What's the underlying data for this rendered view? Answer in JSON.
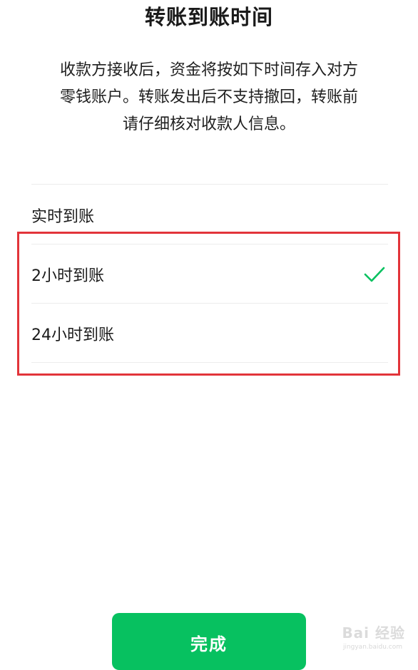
{
  "header": {
    "title": "转账到账时间"
  },
  "description": {
    "lines": [
      "收款方接收后，资金将按如下时间存入对方",
      "零钱账户。转账发出后不支持撤回，转账前",
      "请仔细核对收款人信息。"
    ]
  },
  "options": [
    {
      "label": "实时到账",
      "selected": false
    },
    {
      "label": "2小时到账",
      "selected": true
    },
    {
      "label": "24小时到账",
      "selected": false
    }
  ],
  "footer": {
    "done_label": "完成"
  },
  "watermark": {
    "brand": "Bai 经验",
    "sub": "jingyan.baidu.com"
  },
  "colors": {
    "accent": "#07c160",
    "highlight": "#e2343a"
  }
}
